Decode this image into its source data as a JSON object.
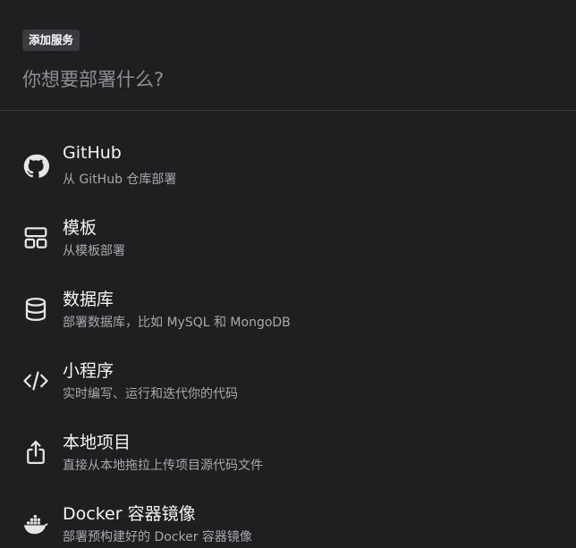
{
  "header": {
    "badge": "添加服务",
    "search_placeholder": "你想要部署什么?"
  },
  "items": [
    {
      "title": "GitHub",
      "description": "从 GitHub 仓库部署",
      "icon": "github-icon"
    },
    {
      "title": "模板",
      "description": "从模板部署",
      "icon": "template-icon"
    },
    {
      "title": "数据库",
      "description": "部署数据库，比如 MySQL 和 MongoDB",
      "icon": "database-icon"
    },
    {
      "title": "小程序",
      "description": "实时编写、运行和迭代你的代码",
      "icon": "code-icon"
    },
    {
      "title": "本地项目",
      "description": "直接从本地拖拉上传项目源代码文件",
      "icon": "upload-icon"
    },
    {
      "title": "Docker 容器镜像",
      "description": "部署预构建好的 Docker 容器镜像",
      "icon": "docker-icon"
    }
  ]
}
